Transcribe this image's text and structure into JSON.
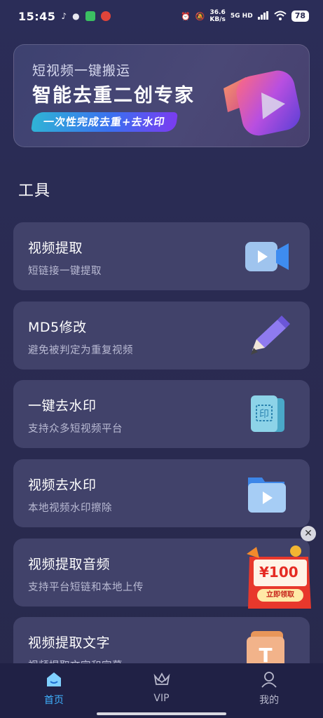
{
  "status_bar": {
    "time": "15:45",
    "speed_value": "36.6",
    "speed_unit": "KB/s",
    "network": "5G HD",
    "battery": "78",
    "icons": [
      "notification-icon",
      "wechat-icon",
      "green-app-icon",
      "red-app-icon",
      "alarm-icon",
      "mute-icon",
      "signal-icon",
      "wifi-icon"
    ]
  },
  "banner": {
    "subtitle": "短视频一键搬运",
    "title": "智能去重二创专家",
    "pill": "一次性完成去重+去水印",
    "art_icon": "video-camera-3d-icon"
  },
  "section": {
    "title": "工具"
  },
  "tools": [
    {
      "title": "视频提取",
      "desc": "短链接一键提取",
      "icon": "video-camera-icon"
    },
    {
      "title": "MD5修改",
      "desc": "避免被判定为重复视频",
      "icon": "pencil-icon"
    },
    {
      "title": "一键去水印",
      "desc": "支持众多短视频平台",
      "icon": "watermark-stamp-icon"
    },
    {
      "title": "视频去水印",
      "desc": "本地视频水印擦除",
      "icon": "video-folder-icon"
    },
    {
      "title": "视频提取音频",
      "desc": "支持平台短链和本地上传",
      "icon": "audio-icon"
    },
    {
      "title": "视频提取文字",
      "desc": "视频提取文字和字幕",
      "icon": "text-icon"
    }
  ],
  "coupon": {
    "amount": "¥100",
    "button": "立即领取",
    "close": "✕"
  },
  "tabs": [
    {
      "label": "首页",
      "icon": "home-icon",
      "active": true
    },
    {
      "label": "VIP",
      "icon": "crown-icon",
      "active": false
    },
    {
      "label": "我的",
      "icon": "user-icon",
      "active": false
    }
  ],
  "colors": {
    "accent": "#3fb2ff",
    "card": "#41426a",
    "background": "#2a2b52"
  }
}
